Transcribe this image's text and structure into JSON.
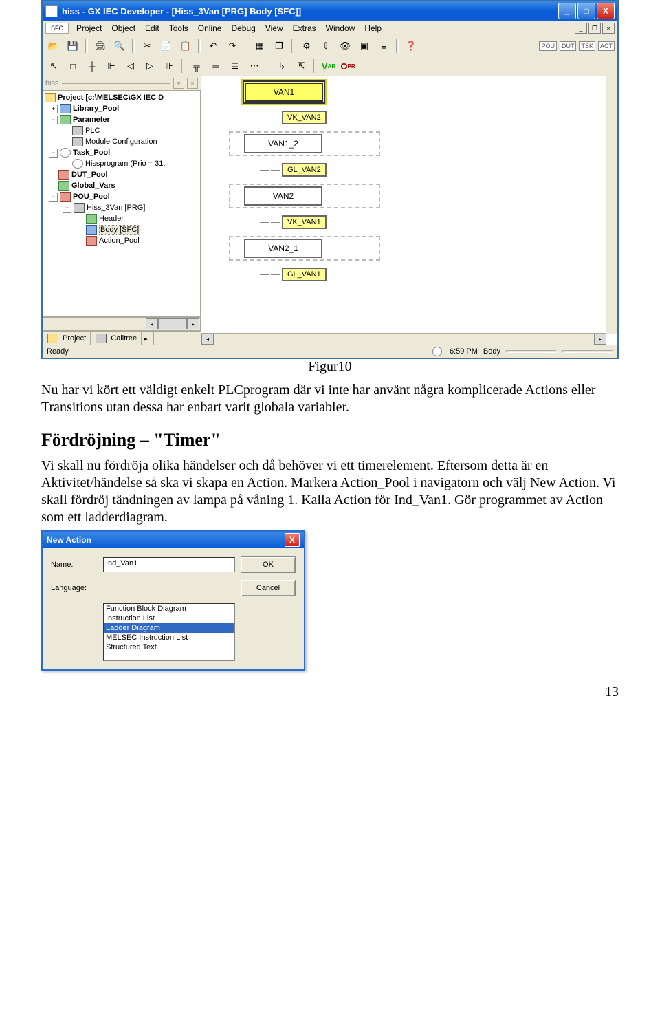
{
  "window": {
    "title": "hiss - GX IEC Developer - [Hiss_3Van [PRG] Body [SFC]]",
    "minimize": "_",
    "maximize": "□",
    "close": "X"
  },
  "menus": [
    "Project",
    "Object",
    "Edit",
    "Tools",
    "Online",
    "Debug",
    "View",
    "Extras",
    "Window",
    "Help"
  ],
  "toolbar_badges": [
    "POU",
    "DUT",
    "TSK",
    "ACT"
  ],
  "nav": {
    "panel": "hiss",
    "root": "Project [c:\\MELSEC\\GX IEC D",
    "items": {
      "library_pool": "Library_Pool",
      "parameter": "Parameter",
      "plc": "PLC",
      "module_cfg": "Module Configuration",
      "task_pool": "Task_Pool",
      "hissprogram": "Hissprogram (Prio = 31,",
      "dut_pool": "DUT_Pool",
      "global_vars": "Global_Vars",
      "pou_pool": "POU_Pool",
      "hiss_3van": "Hiss_3Van [PRG]",
      "header": "Header",
      "body": "Body [SFC]",
      "action_pool": "Action_Pool"
    },
    "tabs": {
      "project": "Project",
      "calltree": "Calltree"
    }
  },
  "sfc": {
    "step_init": "VAN1",
    "t1": "VK_VAN2",
    "step_van1_2": "VAN1_2",
    "t2": "GL_VAN2",
    "step_van2": "VAN2",
    "t3": "VK_VAN1",
    "step_van2_1": "VAN2_1",
    "t4": "GL_VAN1"
  },
  "statusbar": {
    "ready": "Ready",
    "time": "6:59 PM",
    "mode": "Body"
  },
  "doc": {
    "figure_caption": "Figur10",
    "p1": "Nu  har vi kört ett väldigt enkelt PLCprogram där vi inte har använt några komplicerade Actions eller Transitions utan dessa har enbart varit globala variabler.",
    "heading": "Fördröjning – \"Timer\"",
    "p2": "Vi skall nu fördröja olika händelser och då behöver vi ett timerelement. Eftersom detta är en Aktivitet/händelse så ska vi skapa en Action. Markera Action_Pool i navigatorn  och välj New Action. Vi skall fördröj tändningen av lampa på våning 1. Kalla Action för Ind_Van1. Gör programmet av Action som ett ladderdiagram.",
    "page_number": "13"
  },
  "dialog": {
    "title": "New Action",
    "name_label": "Name:",
    "name_value": "Ind_Van1",
    "lang_label": "Language:",
    "ok": "OK",
    "cancel": "Cancel",
    "options": [
      "Function Block Diagram",
      "Instruction List",
      "Ladder Diagram",
      "MELSEC Instruction List",
      "Structured Text"
    ],
    "selected_index": 2
  }
}
